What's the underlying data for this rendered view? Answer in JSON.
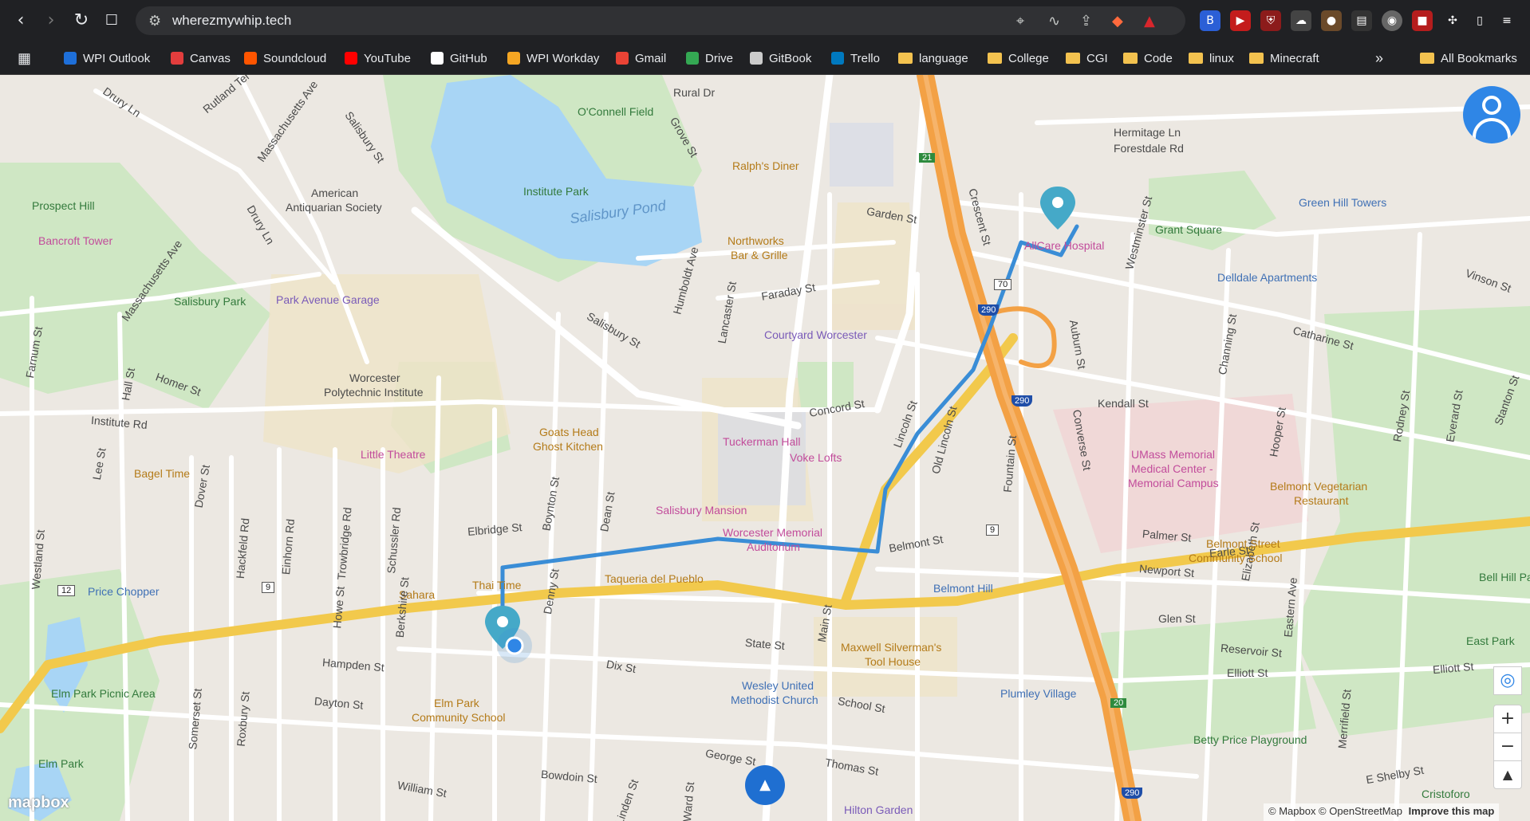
{
  "browser": {
    "url": "wherezmywhip.tech",
    "nav_back": "‹",
    "nav_forward": "›",
    "reload": "↻",
    "bookmarks": [
      {
        "label": "WPI Outlook",
        "color": "#1e6fd9"
      },
      {
        "label": "Canvas",
        "color": "#e23d3d"
      },
      {
        "label": "Soundcloud",
        "color": "#ff5500"
      },
      {
        "label": "YouTube",
        "color": "#ff0000"
      },
      {
        "label": "GitHub",
        "color": "#ffffff"
      },
      {
        "label": "WPI Workday",
        "color": "#f5a623"
      },
      {
        "label": "Gmail",
        "color": "#ea4335"
      },
      {
        "label": "Drive",
        "color": "#34a853"
      },
      {
        "label": "GitBook",
        "color": "#cccccc"
      },
      {
        "label": "Trello",
        "color": "#0079bf"
      },
      {
        "label": "language",
        "color": "folder"
      },
      {
        "label": "College",
        "color": "folder"
      },
      {
        "label": "CGI",
        "color": "folder"
      },
      {
        "label": "Code",
        "color": "folder"
      },
      {
        "label": "linux",
        "color": "folder"
      },
      {
        "label": "Minecraft",
        "color": "folder"
      }
    ],
    "more_bookmarks": "»",
    "all_bookmarks": "All Bookmarks"
  },
  "map": {
    "attribution": "© Mapbox © OpenStreetMap",
    "improve": "Improve this map",
    "logo": "mapbox",
    "zoom_in": "+",
    "zoom_out": "−",
    "compass": "▲",
    "locate": "◎",
    "route_color": "#3a8dd6",
    "labels": {
      "rural_dr": "Rural Dr",
      "oconnell": "O'Connell Field",
      "drury_ln": "Drury Ln",
      "rutland": "Rutland Ter",
      "mass_ave": "Massachusetts Ave",
      "salisbury_st": "Salisbury St",
      "grove_st": "Grove St",
      "ralphs": "Ralph's Diner",
      "hermitage": "Hermitage Ln",
      "forestdale": "Forestdale Rd",
      "prospect_hill": "Prospect Hill",
      "bancroft": "Bancroft Tower",
      "american": "American",
      "antiquarian": "Antiquarian Society",
      "institute_park": "Institute Park",
      "salisbury_pond": "Salisbury Pond",
      "garden_st": "Garden St",
      "crescent_st": "Crescent St",
      "allcare": "AllCare Hospital",
      "westminster": "Westminster St",
      "green_hill": "Green Hill Towers",
      "grant_sq": "Grant Square",
      "northworks1": "Northworks",
      "northworks2": "Bar & Grille",
      "drury_ln2": "Drury Ln",
      "salisbury_park": "Salisbury Park",
      "park_ave_garage": "Park Avenue Garage",
      "mass_ave2": "Massachusetts Ave",
      "humboldt": "Humboldt Ave",
      "lancaster": "Lancaster St",
      "faraday": "Faraday St",
      "delldale": "Delldale Apartments",
      "vinson": "Vinson St",
      "salisbury_st2": "Salisbury St",
      "courtyard": "Courtyard Worcester",
      "catharine": "Catharine St",
      "farnum": "Farnum St",
      "homer": "Homer St",
      "hall_st": "Hall St",
      "wpi1": "Worcester",
      "wpi2": "Polytechnic Institute",
      "auburn": "Auburn St",
      "channing": "Channing St",
      "concord": "Concord St",
      "kendall": "Kendall St",
      "lincoln": "Lincoln St",
      "old_lincoln": "Old Lincoln St",
      "institute_rd": "Institute Rd",
      "goats1": "Goats Head",
      "goats2": "Ghost Kitchen",
      "tuckerman": "Tuckerman Hall",
      "converse": "Converse St",
      "hooper": "Hooper St",
      "little_theatre": "Little Theatre",
      "voke": "Voke Lofts",
      "umass1": "UMass Memorial",
      "umass2": "Medical Center -",
      "umass3": "Memorial Campus",
      "rodney": "Rodney St",
      "everard": "Everard St",
      "stanton": "Stanton St",
      "bagel": "Bagel Time",
      "lee_st": "Lee St",
      "dover": "Dover St",
      "fountain": "Fountain St",
      "belmont_veg1": "Belmont Vegetarian",
      "belmont_veg2": "Restaurant",
      "elbridge": "Elbridge St",
      "boynton": "Boynton St",
      "dean": "Dean St",
      "salisbury_mansion": "Salisbury Mansion",
      "westland": "Westland St",
      "hackfeld": "Hackfeld Rd",
      "einhorn": "Einhorn Rd",
      "trowbridge": "Trowbridge Rd",
      "schussler": "Schussler Rd",
      "memorial1": "Worcester Memorial",
      "memorial2": "Auditorium",
      "belmont_st": "Belmont St",
      "palmer": "Palmer St",
      "earle": "Earle St",
      "elizabeth": "Elizabeth St",
      "belmont_school1": "Belmont Street",
      "belmont_school2": "Community School",
      "price_chopper": "Price Chopper",
      "thai_time": "Thai Time",
      "denny": "Denny St",
      "taqueria": "Taqueria del Pueblo",
      "newport": "Newport St",
      "bell_hill": "Bell Hill Park",
      "sahara": "Sahara",
      "howe": "Howe St",
      "berkshire": "Berkshire St",
      "belmont_hill": "Belmont Hill",
      "glen": "Glen St",
      "eastern": "Eastern Ave",
      "main_st": "Main St",
      "state_st": "State St",
      "maxwell1": "Maxwell Silverman's",
      "maxwell2": "Tool House",
      "reservoir": "Reservoir St",
      "east_park": "East Park",
      "hampden": "Hampden St",
      "dix": "Dix St",
      "elliott": "Elliott St",
      "elliott2": "Elliott St",
      "elm_picnic": "Elm Park Picnic Area",
      "wesley1": "Wesley United",
      "wesley2": "Methodist Church",
      "plumley": "Plumley Village",
      "dayton": "Dayton St",
      "elm_school1": "Elm Park",
      "elm_school2": "Community School",
      "school_st": "School St",
      "somerset": "Somerset St",
      "roxbury": "Roxbury St",
      "merrifield": "Merrifield St",
      "betty": "Betty Price Playground",
      "george": "George St",
      "thomas": "Thomas St",
      "elm_park": "Elm Park",
      "bowdoin": "Bowdoin St",
      "shelby": "E Shelby St",
      "william": "William St",
      "hilton": "Hilton Garden",
      "cristoforo": "Cristoforo",
      "linden": "Linden St",
      "ward": "Ward St"
    },
    "shields": {
      "i290a": "290",
      "i290b": "290",
      "i290c": "290",
      "r9a": "9",
      "r9b": "9",
      "r12": "12",
      "r70": "70",
      "exit21": "21",
      "exit20": "20"
    }
  }
}
